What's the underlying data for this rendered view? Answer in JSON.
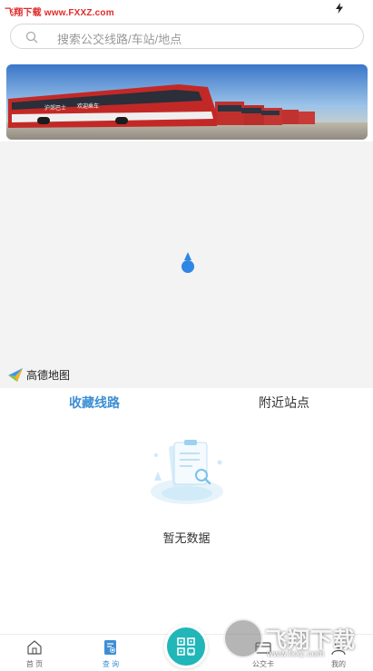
{
  "status_bar": {
    "watermark_text": "飞翔下载 www.FXXZ.com",
    "icon": "bolt-icon"
  },
  "search": {
    "placeholder": "搜索公交线路/车站/地点",
    "icon": "search-icon"
  },
  "banner": {
    "bus_text_1": "沪郊巴士",
    "bus_text_2": "欢迎乘车"
  },
  "map": {
    "logo_text": "高德地图",
    "marker_color": "#2f86e4"
  },
  "tabs": [
    {
      "label": "收藏线路",
      "active": true
    },
    {
      "label": "附近站点",
      "active": false
    }
  ],
  "empty_state": {
    "text": "暂无数据"
  },
  "bottom_nav": {
    "items": [
      {
        "label": "首 页",
        "icon": "home-icon"
      },
      {
        "label": "查 询",
        "icon": "query-icon",
        "active": true
      },
      {
        "label": "公交卡",
        "icon": "bus-card-icon"
      },
      {
        "label": "我的",
        "icon": "profile-icon"
      }
    ],
    "center_icon": "qr-scan-icon"
  },
  "watermark": {
    "title": "飞翔下载",
    "url": "www.fxxz.com"
  },
  "colors": {
    "accent": "#3d8fd4",
    "scan_button": "#21b6b8",
    "watermark_red": "#e02a2a"
  }
}
